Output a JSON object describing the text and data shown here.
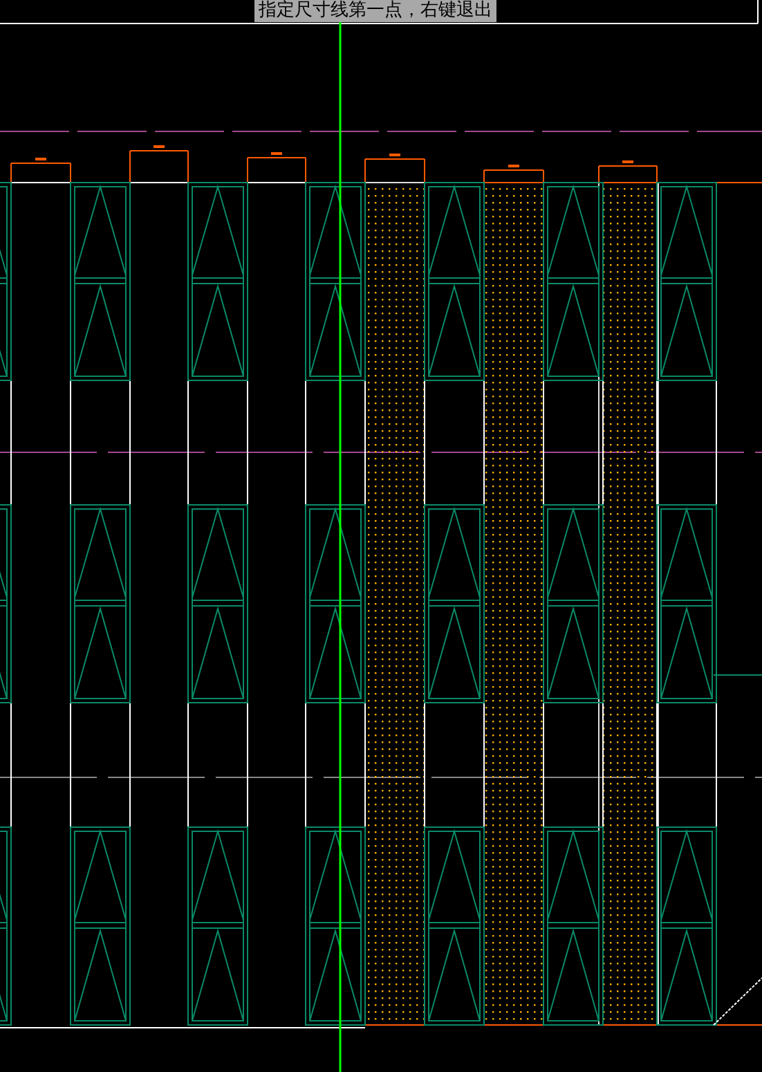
{
  "prompt_tooltip": {
    "text": "指定尺寸线第一点，右键退出"
  }
}
